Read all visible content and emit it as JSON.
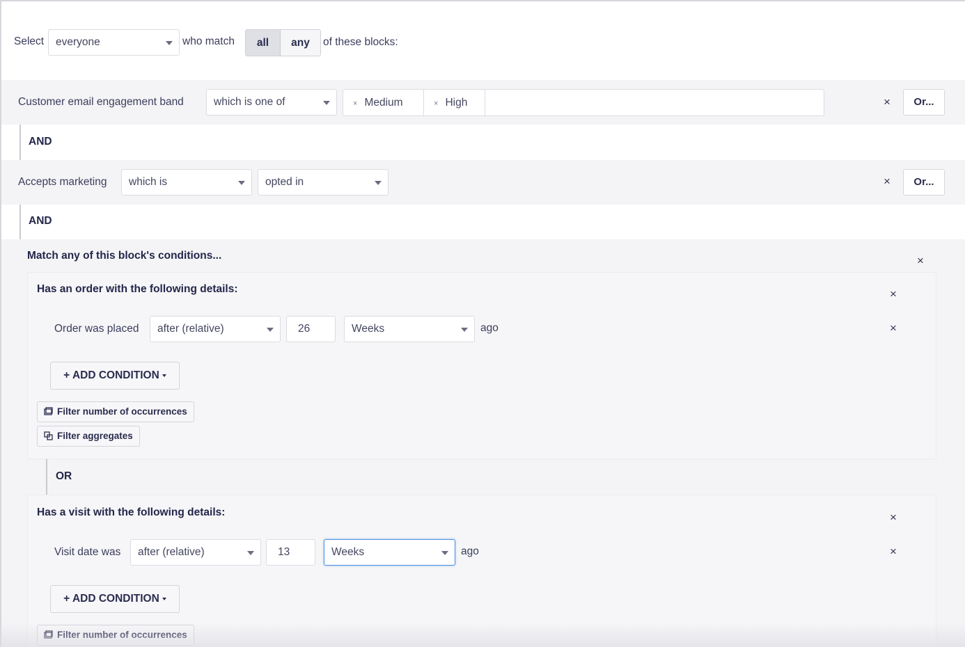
{
  "header": {
    "select_label": "Select",
    "audience_value": "everyone",
    "who_match_label": "who match",
    "match_all": "all",
    "match_any": "any",
    "of_blocks_label": "of these blocks:"
  },
  "condition1": {
    "field_label": "Customer email engagement band",
    "operator": "which is one of",
    "tags": [
      "Medium",
      "High"
    ],
    "remove_icon": "×",
    "or_label": "Or..."
  },
  "and1": "AND",
  "condition2": {
    "field_label": "Accepts marketing",
    "operator": "which is",
    "value": "opted in",
    "remove_icon": "×",
    "or_label": "Or..."
  },
  "and2": "AND",
  "block": {
    "title": "Match any of this block's conditions...",
    "remove_icon": "×",
    "order": {
      "title": "Has an order with the following details:",
      "remove_icon": "×",
      "row_label": "Order was placed",
      "operator": "after (relative)",
      "number": "26",
      "unit": "Weeks",
      "suffix": "ago",
      "row_remove_icon": "×",
      "add_condition_label": "+ ADD CONDITION",
      "filter_occurrences_label": "Filter number of occurrences",
      "filter_aggregates_label": "Filter aggregates"
    },
    "or_label": "OR",
    "visit": {
      "title": "Has a visit with the following details:",
      "remove_icon": "×",
      "row_label": "Visit date was",
      "operator": "after (relative)",
      "number": "13",
      "unit": "Weeks",
      "suffix": "ago",
      "row_remove_icon": "×",
      "add_condition_label": "+ ADD CONDITION",
      "filter_occurrences_label": "Filter number of occurrences"
    }
  },
  "colors": {
    "text": "#2c2e4a",
    "band_bg": "#f4f4f6",
    "focus": "#4a90e2"
  }
}
